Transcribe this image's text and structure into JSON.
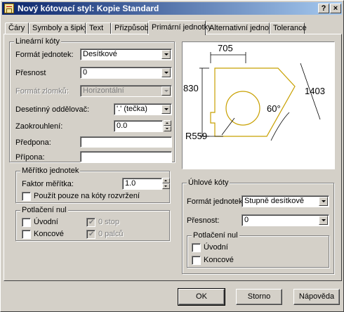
{
  "window": {
    "title": "Nový kótovací styl: Kopie Standard",
    "help_btn": "?",
    "close_btn": "×"
  },
  "tabs": [
    {
      "label": "Čáry"
    },
    {
      "label": "Symboly a šipky"
    },
    {
      "label": "Text"
    },
    {
      "label": "Přizpůsobit"
    },
    {
      "label": "Primární jednotky",
      "active": true
    },
    {
      "label": "Alternativní jednotky"
    },
    {
      "label": "Tolerance"
    }
  ],
  "linear": {
    "legend": "Lineární kóty",
    "unit_format_label": "Formát jednotek:",
    "unit_format_value": "Desítkové",
    "precision_label": "Přesnost",
    "precision_value": "0",
    "fraction_label": "Formát zlomků:",
    "fraction_value": "Horizontální",
    "decimal_sep_label": "Desetinný oddělovač:",
    "decimal_sep_value": "'.' (tečka)",
    "roundoff_label": "Zaokrouhlení:",
    "roundoff_value": "0.0",
    "prefix_label": "Předpona:",
    "prefix_value": "",
    "suffix_label": "Přípona:",
    "suffix_value": ""
  },
  "scale": {
    "legend": "Měřítko jednotek",
    "factor_label": "Faktor měřítka:",
    "factor_value": "1.0",
    "layout_only_label": "Použít pouze na kóty rozvržení",
    "layout_only_checked": false
  },
  "zero_linear": {
    "legend": "Potlačení nul",
    "leading": "Úvodní",
    "trailing": "Koncové",
    "feet": "0 stop",
    "inches": "0 palců"
  },
  "angular": {
    "legend": "Úhlové kóty",
    "unit_format_label": "Formát jednotek:",
    "unit_format_value": "Stupně desítkově",
    "precision_label": "Přesnost:",
    "precision_value": "0"
  },
  "zero_angular": {
    "legend": "Potlačení nul",
    "leading": "Úvodní",
    "trailing": "Koncové"
  },
  "preview": {
    "dim_top": "705",
    "dim_left": "830",
    "dim_right": "1403",
    "dim_angle": "60°",
    "dim_radius": "R559"
  },
  "buttons": {
    "ok": "OK",
    "cancel": "Storno",
    "help": "Nápověda"
  }
}
